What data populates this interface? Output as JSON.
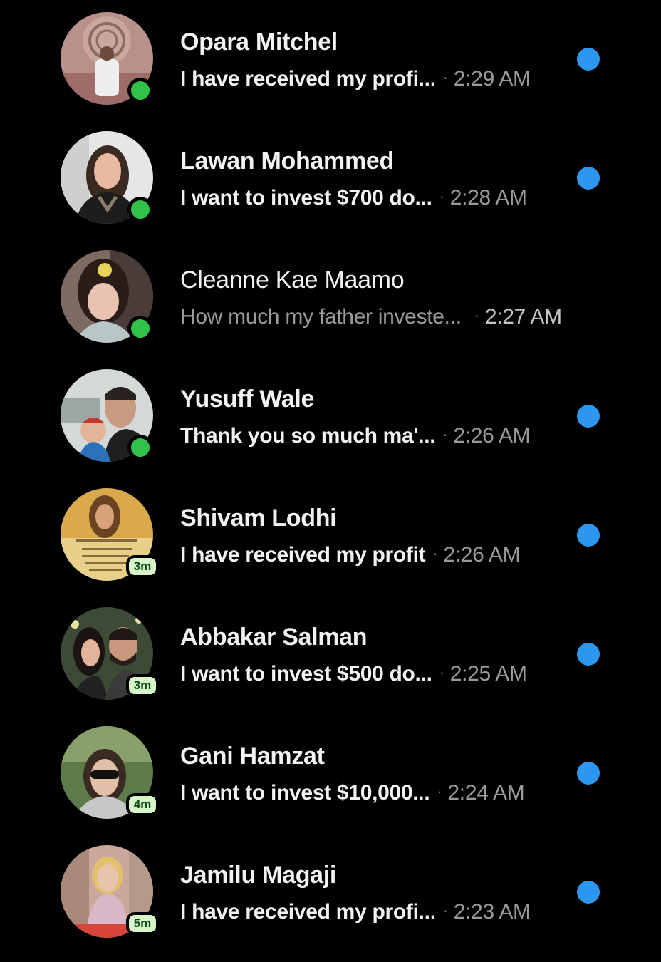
{
  "colors": {
    "background": "#000000",
    "online": "#31c24a",
    "unread_dot": "#2d97f0",
    "badge_bg": "#d8f5c9",
    "badge_text": "#0b4a13"
  },
  "conversations": [
    {
      "name": "Opara Mitchel",
      "preview": "I have received my profi...",
      "time": "2:29 AM",
      "unread": true,
      "status": "online",
      "badge": ""
    },
    {
      "name": "Lawan Mohammed",
      "preview": "I want to invest $700 do...",
      "time": "2:28 AM",
      "unread": true,
      "status": "online",
      "badge": ""
    },
    {
      "name": "Cleanne Kae Maamo",
      "preview": "How much my father investe...",
      "time": "2:27 AM",
      "unread": false,
      "status": "online",
      "badge": ""
    },
    {
      "name": "Yusuff Wale",
      "preview": "Thank you so much ma'...",
      "time": "2:26 AM",
      "unread": true,
      "status": "online",
      "badge": ""
    },
    {
      "name": "Shivam Lodhi",
      "preview": "I have received my profit",
      "time": "2:26 AM",
      "unread": true,
      "status": "away",
      "badge": "3m"
    },
    {
      "name": "Abbakar Salman",
      "preview": "I want to invest $500 do...",
      "time": "2:25 AM",
      "unread": true,
      "status": "away",
      "badge": "3m"
    },
    {
      "name": "Gani Hamzat",
      "preview": "I want to invest $10,000...",
      "time": "2:24 AM",
      "unread": true,
      "status": "away",
      "badge": "4m"
    },
    {
      "name": "Jamilu Magaji",
      "preview": "I have received my profi...",
      "time": "2:23 AM",
      "unread": true,
      "status": "away",
      "badge": "5m"
    }
  ]
}
